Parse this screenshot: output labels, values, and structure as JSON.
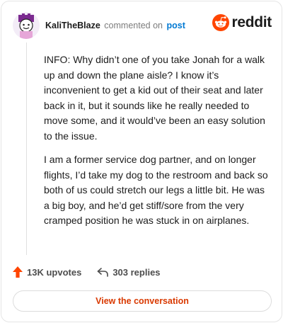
{
  "header": {
    "username": "KaliTheBlaze",
    "action_text": "commented on",
    "post_link": "post",
    "brand": "reddit"
  },
  "comment": {
    "paragraphs": [
      "INFO: Why didn’t one of you take Jonah for a walk up and down the plane aisle? I know it’s inconvenient to get a kid out of their seat and later back in it, but it sounds like he really needed to move some, and it would’ve been an easy solution to the issue.",
      "I am a former service dog partner, and on longer flights, I’d take my dog to the restroom and back so both of us could stretch our legs a little bit. He was a big boy, and he’d get stiff/sore from the very cramped position he was stuck in on airplanes."
    ]
  },
  "footer": {
    "upvotes": "13K upvotes",
    "replies": "303 replies",
    "view_button": "View the conversation"
  },
  "icons": {
    "upvote": "upvote-arrow-icon",
    "reply": "reply-arrow-icon",
    "logo": "reddit-snoo-icon"
  },
  "colors": {
    "brand_orange": "#ff4500",
    "link_blue": "#0079d3",
    "cta_text": "#d93900"
  }
}
